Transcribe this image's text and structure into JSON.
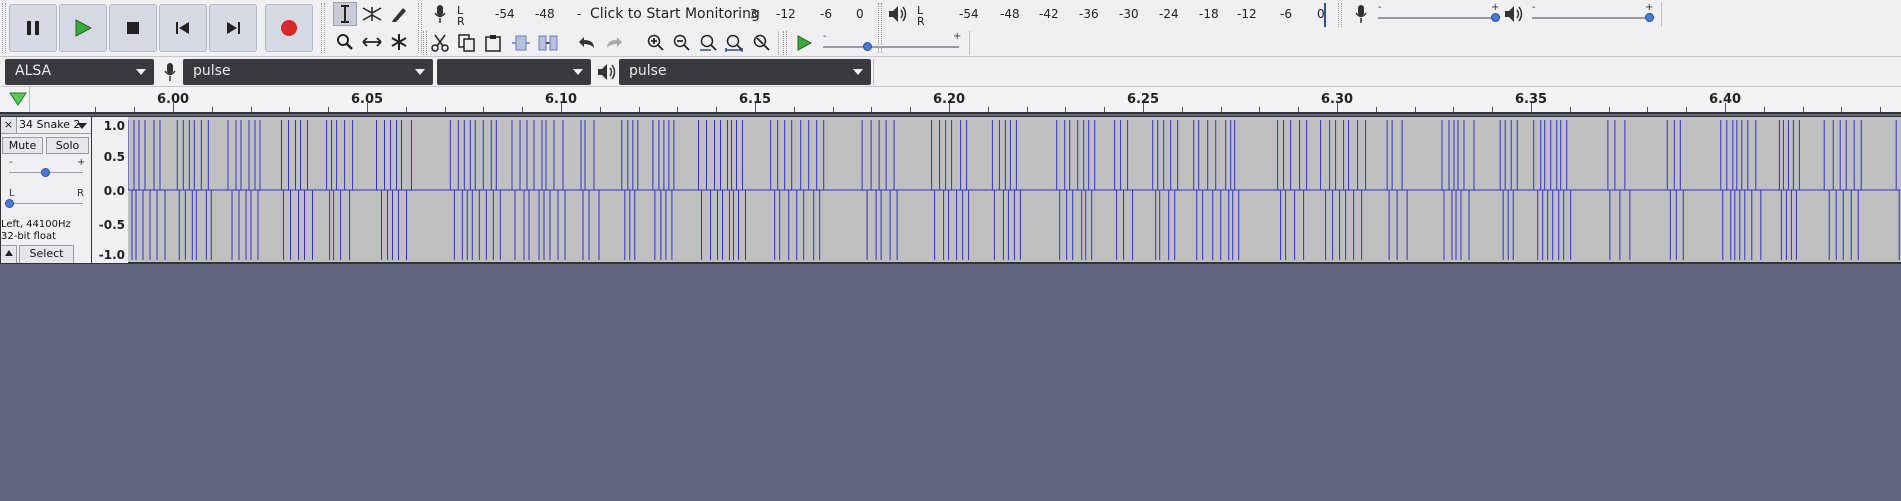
{
  "transport": {
    "pause": "Pause",
    "play": "Play",
    "stop": "Stop",
    "skip_start": "Skip to Start",
    "skip_end": "Skip to End",
    "record": "Record"
  },
  "tools": {
    "selection": "selection-tool",
    "envelope": "envelope-tool",
    "draw": "draw-tool",
    "zoom": "zoom-tool",
    "timeshift": "time-shift-tool",
    "multi": "multi-tool"
  },
  "record_meter": {
    "l": "L",
    "r": "R",
    "scale": [
      "-54",
      "-48",
      "-",
      "3",
      "-12",
      "-6",
      "0"
    ],
    "monitor_text": "Click to Start Monitoring"
  },
  "playback_meter": {
    "l": "L",
    "r": "R",
    "scale": [
      "-54",
      "-48",
      "-42",
      "-36",
      "-30",
      "-24",
      "-18",
      "-12",
      "-6",
      "0"
    ]
  },
  "mixer": {
    "rec_minus": "-",
    "rec_plus": "+",
    "play_minus": "-",
    "play_plus": "+",
    "rec_level": 0.98,
    "play_level": 0.98
  },
  "play_at_speed": {
    "minus": "-",
    "plus": "+",
    "level": 0.33
  },
  "devices": {
    "host": "ALSA",
    "recording_device": "pulse",
    "channels": "",
    "playback_device": "pulse"
  },
  "ruler": {
    "labels": [
      "6.00",
      "6.05",
      "6.10",
      "6.15",
      "6.20",
      "6.25",
      "6.30",
      "6.35",
      "6.40"
    ]
  },
  "track": {
    "close": "×",
    "name": "34 Snake 2",
    "mute": "Mute",
    "solo": "Solo",
    "gain_minus": "-",
    "gain_plus": "+",
    "pan_left": "L",
    "pan_right": "R",
    "info_line1": "Left, 44100Hz",
    "info_line2": "32-bit float",
    "select": "Select",
    "vruler": [
      "1.0",
      "0.5",
      "0.0",
      "-0.5",
      "-1.0"
    ]
  },
  "colors": {
    "waveform": "#3232c8",
    "background": "#62657f",
    "record": "#d62a2a",
    "play": "#3da83d"
  }
}
